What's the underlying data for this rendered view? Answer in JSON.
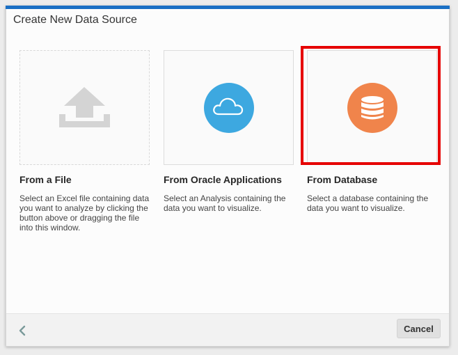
{
  "dialog": {
    "title": "Create New Data Source",
    "accent_color": "#1a6fc4"
  },
  "options": [
    {
      "title": "From a File",
      "description": "Select an Excel file containing data you want to analyze by clicking the button above or dragging the file into this window.",
      "icon": "upload-icon",
      "icon_color": "#d4d4d4"
    },
    {
      "title": "From Oracle Applications",
      "description": "Select an Analysis containing the data you want to visualize.",
      "icon": "cloud-icon",
      "icon_color": "#3da8e0"
    },
    {
      "title": "From Database",
      "description": "Select a database containing the data you want to visualize.",
      "icon": "database-icon",
      "icon_color": "#f0844b",
      "highlighted": true,
      "highlight_color": "#e60000"
    }
  ],
  "footer": {
    "back_icon": "chevron-left-icon",
    "cancel_label": "Cancel"
  }
}
